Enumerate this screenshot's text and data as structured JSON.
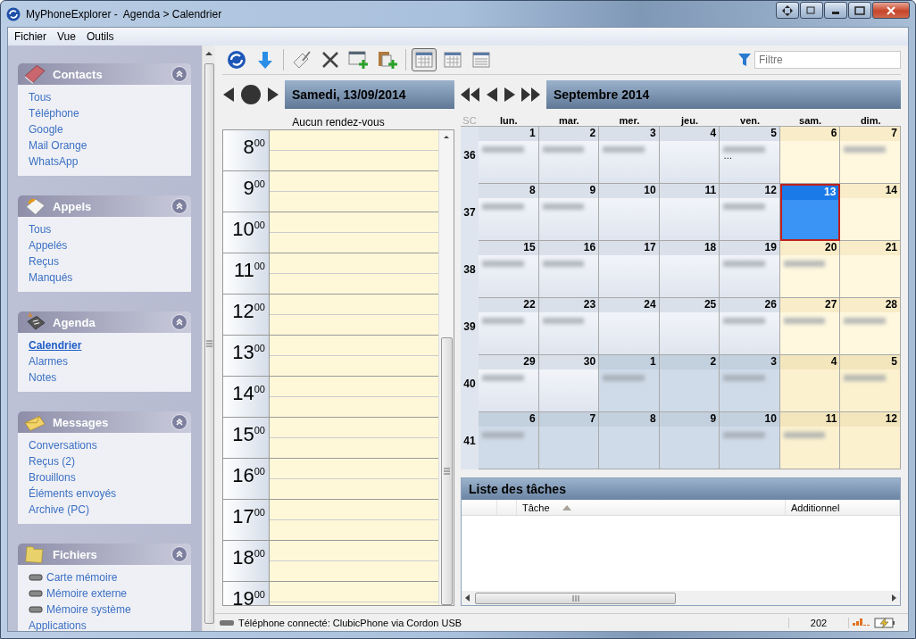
{
  "window": {
    "title": "MyPhoneExplorer -  Agenda > Calendrier"
  },
  "menu": [
    "Fichier",
    "Vue",
    "Outils"
  ],
  "sidebar": {
    "sections": [
      {
        "title": "Contacts",
        "items": [
          {
            "label": "Tous",
            "selected": false,
            "kind": "link"
          },
          {
            "label": "Téléphone",
            "selected": false,
            "kind": "link"
          },
          {
            "label": "Google",
            "selected": false,
            "kind": "link"
          },
          {
            "label": "Mail Orange",
            "selected": false,
            "kind": "link"
          },
          {
            "label": "WhatsApp",
            "selected": false,
            "kind": "link"
          }
        ]
      },
      {
        "title": "Appels",
        "items": [
          {
            "label": "Tous",
            "selected": false,
            "kind": "link"
          },
          {
            "label": "Appelés",
            "selected": false,
            "kind": "link"
          },
          {
            "label": "Reçus",
            "selected": false,
            "kind": "link"
          },
          {
            "label": "Manqués",
            "selected": false,
            "kind": "link"
          }
        ]
      },
      {
        "title": "Agenda",
        "items": [
          {
            "label": "Calendrier",
            "selected": true,
            "kind": "link"
          },
          {
            "label": "Alarmes",
            "selected": false,
            "kind": "link"
          },
          {
            "label": "Notes",
            "selected": false,
            "kind": "link"
          }
        ]
      },
      {
        "title": "Messages",
        "items": [
          {
            "label": "Conversations",
            "selected": false,
            "kind": "link"
          },
          {
            "label": "Reçus (2)",
            "selected": false,
            "kind": "link"
          },
          {
            "label": "Brouillons",
            "selected": false,
            "kind": "link"
          },
          {
            "label": "Éléments envoyés",
            "selected": false,
            "kind": "link"
          },
          {
            "label": "Archive (PC)",
            "selected": false,
            "kind": "link"
          }
        ]
      },
      {
        "title": "Fichiers",
        "items": [
          {
            "label": "Carte mémoire",
            "selected": false,
            "kind": "drive"
          },
          {
            "label": "Mémoire externe",
            "selected": false,
            "kind": "drive"
          },
          {
            "label": "Mémoire système",
            "selected": false,
            "kind": "drive"
          },
          {
            "label": "Applications",
            "selected": false,
            "kind": "link"
          }
        ]
      }
    ]
  },
  "toolbar": {
    "views": [
      {
        "selected": true
      },
      {
        "selected": false
      },
      {
        "selected": false
      }
    ],
    "filter": {
      "placeholder": "Filtre"
    }
  },
  "day_view": {
    "date": "Samedi, 13/09/2014",
    "summary": "Aucun rendez-vous",
    "hours": [
      {
        "hour": "8",
        "minutes": "00"
      },
      {
        "hour": "9",
        "minutes": "00"
      },
      {
        "hour": "10",
        "minutes": "00"
      },
      {
        "hour": "11",
        "minutes": "00"
      },
      {
        "hour": "12",
        "minutes": "00"
      },
      {
        "hour": "13",
        "minutes": "00"
      },
      {
        "hour": "14",
        "minutes": "00"
      },
      {
        "hour": "15",
        "minutes": "00"
      },
      {
        "hour": "16",
        "minutes": "00"
      },
      {
        "hour": "17",
        "minutes": "00"
      },
      {
        "hour": "18",
        "minutes": "00"
      },
      {
        "hour": "19",
        "minutes": "00"
      }
    ]
  },
  "month_view": {
    "title": "Septembre 2014",
    "week_label": "SC",
    "weekdays": [
      "lun.",
      "mar.",
      "mer.",
      "jeu.",
      "ven.",
      "sam.",
      "dim."
    ],
    "weeks": [
      {
        "number": "36",
        "days": [
          {
            "day": "1",
            "in_month": true,
            "weekend": false,
            "selected": false,
            "blurred_entry": true
          },
          {
            "day": "2",
            "in_month": true,
            "weekend": false,
            "selected": false,
            "blurred_entry": true
          },
          {
            "day": "3",
            "in_month": true,
            "weekend": false,
            "selected": false,
            "blurred_entry": true
          },
          {
            "day": "4",
            "in_month": true,
            "weekend": false,
            "selected": false,
            "blurred_entry": false
          },
          {
            "day": "5",
            "in_month": true,
            "weekend": false,
            "selected": false,
            "blurred_entry": true,
            "more": "…"
          },
          {
            "day": "6",
            "in_month": true,
            "weekend": true,
            "selected": false,
            "blurred_entry": false
          },
          {
            "day": "7",
            "in_month": true,
            "weekend": true,
            "selected": false,
            "blurred_entry": true
          }
        ]
      },
      {
        "number": "37",
        "days": [
          {
            "day": "8",
            "in_month": true,
            "weekend": false,
            "selected": false,
            "blurred_entry": true
          },
          {
            "day": "9",
            "in_month": true,
            "weekend": false,
            "selected": false,
            "blurred_entry": true
          },
          {
            "day": "10",
            "in_month": true,
            "weekend": false,
            "selected": false,
            "blurred_entry": false
          },
          {
            "day": "11",
            "in_month": true,
            "weekend": false,
            "selected": false,
            "blurred_entry": false
          },
          {
            "day": "12",
            "in_month": true,
            "weekend": false,
            "selected": false,
            "blurred_entry": true
          },
          {
            "day": "13",
            "in_month": true,
            "weekend": true,
            "selected": true,
            "blurred_entry": false
          },
          {
            "day": "14",
            "in_month": true,
            "weekend": true,
            "selected": false,
            "blurred_entry": false
          }
        ]
      },
      {
        "number": "38",
        "days": [
          {
            "day": "15",
            "in_month": true,
            "weekend": false,
            "selected": false,
            "blurred_entry": true
          },
          {
            "day": "16",
            "in_month": true,
            "weekend": false,
            "selected": false,
            "blurred_entry": true
          },
          {
            "day": "17",
            "in_month": true,
            "weekend": false,
            "selected": false,
            "blurred_entry": false
          },
          {
            "day": "18",
            "in_month": true,
            "weekend": false,
            "selected": false,
            "blurred_entry": false
          },
          {
            "day": "19",
            "in_month": true,
            "weekend": false,
            "selected": false,
            "blurred_entry": true
          },
          {
            "day": "20",
            "in_month": true,
            "weekend": true,
            "selected": false,
            "blurred_entry": true
          },
          {
            "day": "21",
            "in_month": true,
            "weekend": true,
            "selected": false,
            "blurred_entry": false
          }
        ]
      },
      {
        "number": "39",
        "days": [
          {
            "day": "22",
            "in_month": true,
            "weekend": false,
            "selected": false,
            "blurred_entry": true
          },
          {
            "day": "23",
            "in_month": true,
            "weekend": false,
            "selected": false,
            "blurred_entry": true
          },
          {
            "day": "24",
            "in_month": true,
            "weekend": false,
            "selected": false,
            "blurred_entry": false
          },
          {
            "day": "25",
            "in_month": true,
            "weekend": false,
            "selected": false,
            "blurred_entry": false
          },
          {
            "day": "26",
            "in_month": true,
            "weekend": false,
            "selected": false,
            "blurred_entry": true
          },
          {
            "day": "27",
            "in_month": true,
            "weekend": true,
            "selected": false,
            "blurred_entry": true
          },
          {
            "day": "28",
            "in_month": true,
            "weekend": true,
            "selected": false,
            "blurred_entry": true
          }
        ]
      },
      {
        "number": "40",
        "days": [
          {
            "day": "29",
            "in_month": true,
            "weekend": false,
            "selected": false,
            "blurred_entry": true
          },
          {
            "day": "30",
            "in_month": true,
            "weekend": false,
            "selected": false,
            "blurred_entry": false
          },
          {
            "day": "1",
            "in_month": false,
            "weekend": false,
            "selected": false,
            "blurred_entry": true
          },
          {
            "day": "2",
            "in_month": false,
            "weekend": false,
            "selected": false,
            "blurred_entry": false
          },
          {
            "day": "3",
            "in_month": false,
            "weekend": false,
            "selected": false,
            "blurred_entry": true
          },
          {
            "day": "4",
            "in_month": false,
            "weekend": true,
            "selected": false,
            "blurred_entry": false
          },
          {
            "day": "5",
            "in_month": false,
            "weekend": true,
            "selected": false,
            "blurred_entry": true
          }
        ]
      },
      {
        "number": "41",
        "days": [
          {
            "day": "6",
            "in_month": false,
            "weekend": false,
            "selected": false,
            "blurred_entry": true
          },
          {
            "day": "7",
            "in_month": false,
            "weekend": false,
            "selected": false,
            "blurred_entry": false
          },
          {
            "day": "8",
            "in_month": false,
            "weekend": false,
            "selected": false,
            "blurred_entry": false
          },
          {
            "day": "9",
            "in_month": false,
            "weekend": false,
            "selected": false,
            "blurred_entry": false
          },
          {
            "day": "10",
            "in_month": false,
            "weekend": false,
            "selected": false,
            "blurred_entry": true
          },
          {
            "day": "11",
            "in_month": false,
            "weekend": true,
            "selected": false,
            "blurred_entry": true
          },
          {
            "day": "12",
            "in_month": false,
            "weekend": true,
            "selected": false,
            "blurred_entry": false
          }
        ]
      }
    ]
  },
  "tasks": {
    "title": "Liste des tâches",
    "columns": [
      {
        "label": "Tâche",
        "sorted": true
      },
      {
        "label": "Additionnel",
        "sorted": false
      }
    ]
  },
  "status_bar": {
    "connection": "Téléphone connecté: ClubicPhone via Cordon USB",
    "count": "202"
  }
}
